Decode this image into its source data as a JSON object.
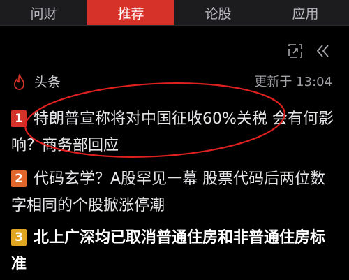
{
  "tabs": [
    {
      "label": "问财",
      "active": false
    },
    {
      "label": "推荐",
      "active": true
    },
    {
      "label": "论股",
      "active": false
    },
    {
      "label": "应用",
      "active": false
    }
  ],
  "toolbar": {
    "expand_icon": "expand-icon",
    "collapse_icon": "collapse-double-chevron-icon"
  },
  "section": {
    "icon": "flame-icon",
    "title": "头条",
    "update_time": "更新于 13:04"
  },
  "news": [
    {
      "rank": "1",
      "rank_color": "#d6322a",
      "text": "特朗普宣称将对中国征收60%关税 会有何影响？商务部回应"
    },
    {
      "rank": "2",
      "rank_color": "#e0662b",
      "text": "代码玄学？A股罕见一幕 股票代码后两位数字相同的个股掀涨停潮"
    },
    {
      "rank": "3",
      "rank_color": "#e0a521",
      "text": "北上广深均已取消普通住房和非普通住房标准"
    }
  ],
  "colors": {
    "accent": "#d6322a",
    "annotation": "#e02020"
  }
}
